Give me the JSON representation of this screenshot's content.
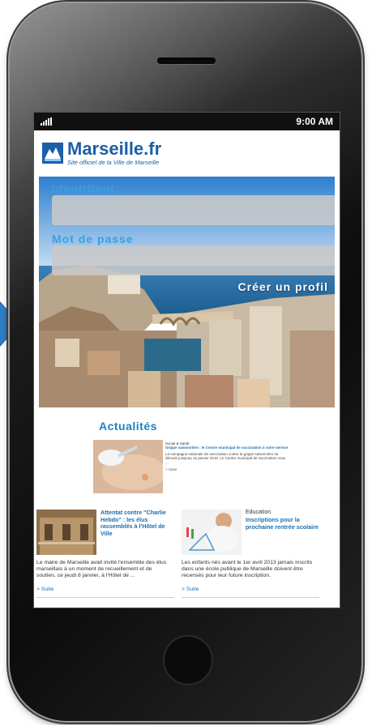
{
  "status_bar": {
    "time": "9:00 AM",
    "signal_icon": "signal-bars-icon"
  },
  "header": {
    "logo_icon": "marseille-logo-icon",
    "title": "Marseille.fr",
    "subtitle": "Site officiel de la Ville de Marseille"
  },
  "login": {
    "identifiant_label": "Identifiant",
    "identifiant_value": "",
    "password_label": "Mot de passe",
    "password_value": "",
    "create_profile_label": "Créer un profil"
  },
  "news": {
    "section_title": "Actualités",
    "featured": {
      "category": "Social & Santé",
      "title": "Grippe saisonnière : le Centre municipal de vaccination à votre service",
      "excerpt": "La campagne nationale de vaccination contre la grippe saisonnière se déroule jusqu'au 31 janvier 2015. Le Centre municipal de vaccination vous ...",
      "more": "> Suite"
    },
    "items": [
      {
        "category": "",
        "title": "Attentat contre \"Charlie Hebdo\" : les élus rassemblés à l'Hôtel de Ville",
        "excerpt": "Le maire de Marseille avait invité l'ensemble des élus marseillais à un moment de recueillement et de soutien, ce jeudi 8 janvier, à l'Hôtel de ...",
        "more": "> Suite"
      },
      {
        "category": "Education",
        "title": "Inscriptions pour la prochaine rentrée scolaire",
        "excerpt": "Les enfants nés avant le 1er avril 2013 jamais inscrits dans une école publique de Marseille doivent être recensés pour leur future inscription.",
        "more": "> Suite"
      }
    ]
  },
  "colors": {
    "brand_blue": "#1a5fa8",
    "label_blue": "#3aa0e0",
    "phone_body": "#111111"
  }
}
